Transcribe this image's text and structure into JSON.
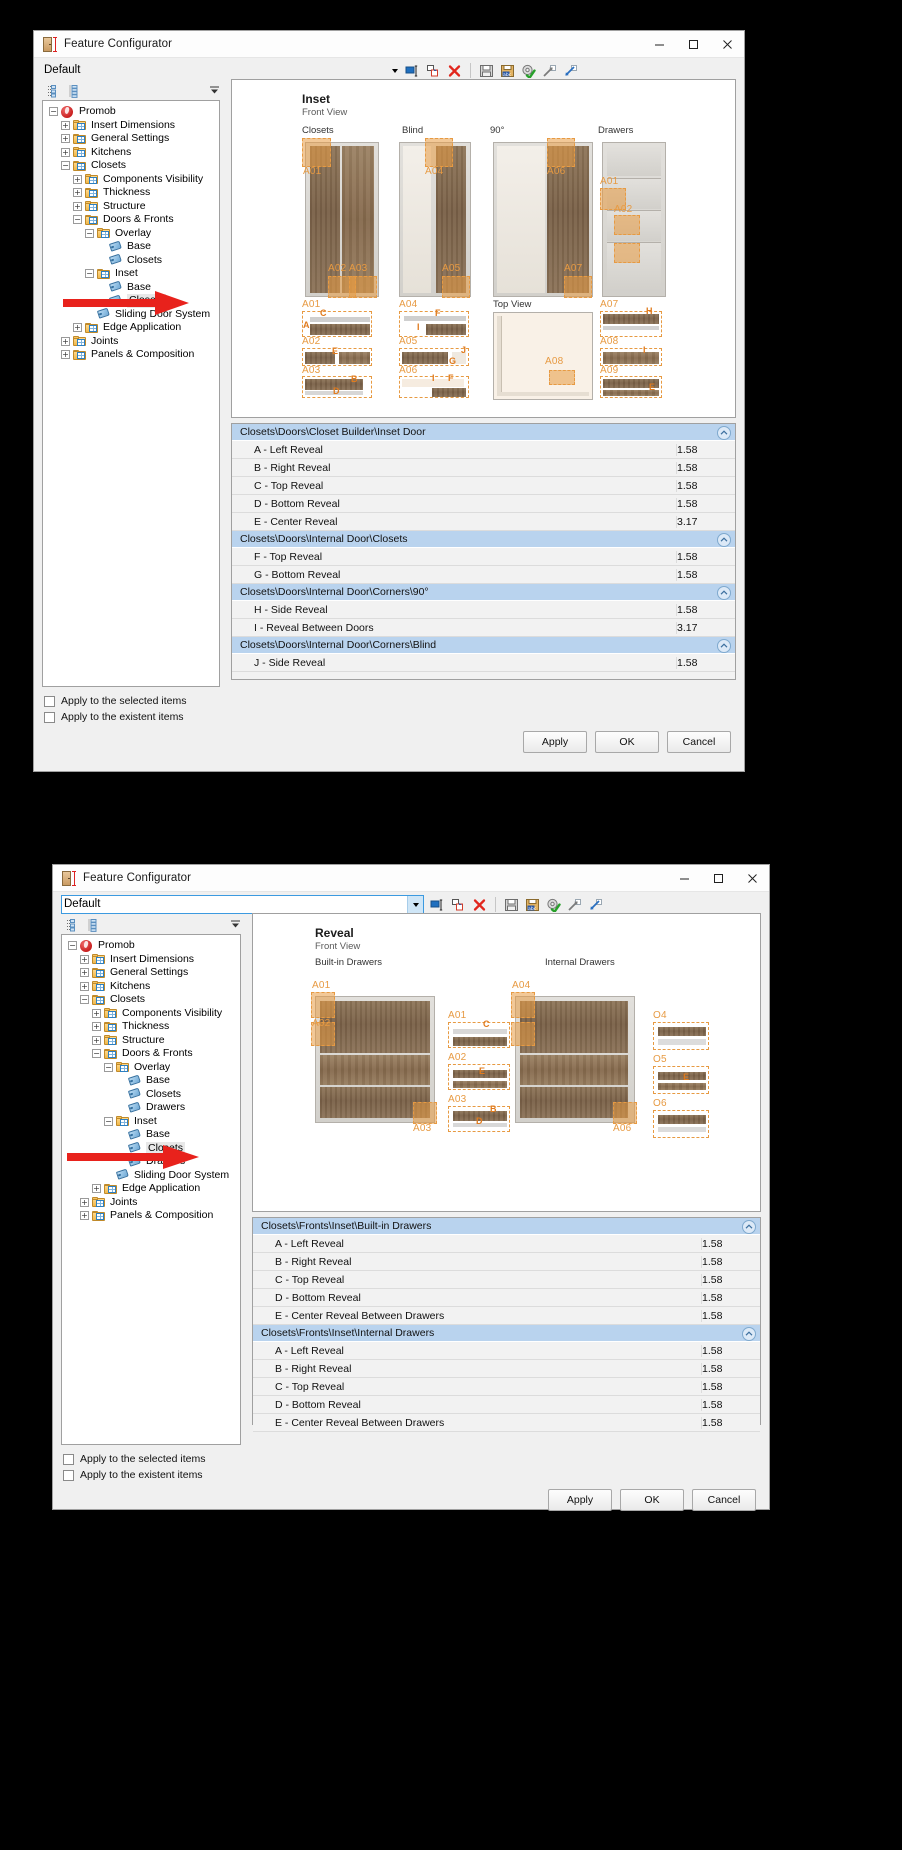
{
  "window1": {
    "title": "Feature Configurator",
    "profile_value": "Default",
    "window_buttons": {
      "minimize": "minimize-button",
      "maximize": "maximize-button",
      "close": "close-button"
    },
    "toolbar_icons": [
      "rename-icon",
      "duplicate-icon",
      "delete-icon",
      "save-icon",
      "save-as-icon",
      "validate-icon",
      "export-icon",
      "import-icon"
    ],
    "tree": [
      {
        "label": "Promob",
        "level": 0,
        "icon": "promob-icon",
        "expander": "-"
      },
      {
        "label": "Insert Dimensions",
        "level": 1,
        "icon": "folder-icon",
        "expander": "+"
      },
      {
        "label": "General Settings",
        "level": 1,
        "icon": "folder-icon",
        "expander": "+"
      },
      {
        "label": "Kitchens",
        "level": 1,
        "icon": "folder-icon",
        "expander": "+"
      },
      {
        "label": "Closets",
        "level": 1,
        "icon": "folder-icon",
        "expander": "-"
      },
      {
        "label": "Components Visibility",
        "level": 2,
        "icon": "folder-icon",
        "expander": "+"
      },
      {
        "label": "Thickness",
        "level": 2,
        "icon": "folder-icon",
        "expander": "+"
      },
      {
        "label": "Structure",
        "level": 2,
        "icon": "folder-icon",
        "expander": "+"
      },
      {
        "label": "Doors & Fronts",
        "level": 2,
        "icon": "folder-icon",
        "expander": "-"
      },
      {
        "label": "Overlay",
        "level": 3,
        "icon": "folder-icon",
        "expander": "-"
      },
      {
        "label": "Base",
        "level": 4,
        "icon": "tag-icon",
        "expander": ""
      },
      {
        "label": "Closets",
        "level": 4,
        "icon": "tag-icon",
        "expander": ""
      },
      {
        "label": "Inset",
        "level": 3,
        "icon": "folder-icon",
        "expander": "-"
      },
      {
        "label": "Base",
        "level": 4,
        "icon": "tag-icon",
        "expander": ""
      },
      {
        "label": "Closets",
        "level": 4,
        "icon": "tag-icon",
        "expander": "",
        "selected": true
      },
      {
        "label": "Sliding Door System",
        "level": 3,
        "icon": "tag-icon",
        "expander": ""
      },
      {
        "label": "Edge Application",
        "level": 2,
        "icon": "folder-icon",
        "expander": "+"
      },
      {
        "label": "Joints",
        "level": 1,
        "icon": "folder-icon",
        "expander": "+"
      },
      {
        "label": "Panels & Composition",
        "level": 1,
        "icon": "folder-icon",
        "expander": "+"
      }
    ],
    "preview": {
      "title": "Inset",
      "subtitle": "Front View",
      "columns": [
        "Closets",
        "Blind",
        "90°",
        "Drawers"
      ],
      "top_view_caption": "Top View",
      "callouts": [
        "A01",
        "A02",
        "A03",
        "A04",
        "A05",
        "A06",
        "A07",
        "A08",
        "A09"
      ],
      "dimension_letters": [
        "A",
        "B",
        "C",
        "D",
        "E",
        "F",
        "G",
        "H",
        "I",
        "J"
      ]
    },
    "property_groups": [
      {
        "header": "Closets\\Doors\\Closet Builder\\Inset Door",
        "rows": [
          {
            "name": "A - Left Reveal",
            "value": "1.58"
          },
          {
            "name": "B - Right Reveal",
            "value": "1.58"
          },
          {
            "name": "C - Top Reveal",
            "value": "1.58"
          },
          {
            "name": "D - Bottom Reveal",
            "value": "1.58"
          },
          {
            "name": "E - Center Reveal",
            "value": "3.17"
          }
        ]
      },
      {
        "header": "Closets\\Doors\\Internal Door\\Closets",
        "rows": [
          {
            "name": "F - Top Reveal",
            "value": "1.58"
          },
          {
            "name": "G - Bottom Reveal",
            "value": "1.58"
          }
        ]
      },
      {
        "header": "Closets\\Doors\\Internal Door\\Corners\\90°",
        "rows": [
          {
            "name": "H - Side Reveal",
            "value": "1.58"
          },
          {
            "name": "I - Reveal Between Doors",
            "value": "3.17"
          }
        ]
      },
      {
        "header": "Closets\\Doors\\Internal Door\\Corners\\Blind",
        "rows": [
          {
            "name": "J - Side Reveal",
            "value": "1.58"
          }
        ]
      }
    ],
    "footer": {
      "checkbox_selected": "Apply to the selected items",
      "checkbox_existent": "Apply to the existent items",
      "apply": "Apply",
      "ok": "OK",
      "cancel": "Cancel"
    }
  },
  "window2": {
    "title": "Feature Configurator",
    "profile_value": "Default",
    "window_buttons": {
      "minimize": "minimize-button",
      "maximize": "maximize-button",
      "close": "close-button"
    },
    "toolbar_icons": [
      "rename-icon",
      "duplicate-icon",
      "delete-icon",
      "save-icon",
      "save-as-icon",
      "validate-icon",
      "export-icon",
      "import-icon"
    ],
    "tree": [
      {
        "label": "Promob",
        "level": 0,
        "icon": "promob-icon",
        "expander": "-"
      },
      {
        "label": "Insert Dimensions",
        "level": 1,
        "icon": "folder-icon",
        "expander": "+"
      },
      {
        "label": "General Settings",
        "level": 1,
        "icon": "folder-icon",
        "expander": "+"
      },
      {
        "label": "Kitchens",
        "level": 1,
        "icon": "folder-icon",
        "expander": "+"
      },
      {
        "label": "Closets",
        "level": 1,
        "icon": "folder-icon",
        "expander": "-"
      },
      {
        "label": "Components Visibility",
        "level": 2,
        "icon": "folder-icon",
        "expander": "+"
      },
      {
        "label": "Thickness",
        "level": 2,
        "icon": "folder-icon",
        "expander": "+"
      },
      {
        "label": "Structure",
        "level": 2,
        "icon": "folder-icon",
        "expander": "+"
      },
      {
        "label": "Doors & Fronts",
        "level": 2,
        "icon": "folder-icon",
        "expander": "-"
      },
      {
        "label": "Overlay",
        "level": 3,
        "icon": "folder-icon",
        "expander": "-"
      },
      {
        "label": "Base",
        "level": 4,
        "icon": "tag-icon",
        "expander": ""
      },
      {
        "label": "Closets",
        "level": 4,
        "icon": "tag-icon",
        "expander": ""
      },
      {
        "label": "Drawers",
        "level": 4,
        "icon": "tag-icon",
        "expander": ""
      },
      {
        "label": "Inset",
        "level": 3,
        "icon": "folder-icon",
        "expander": "-"
      },
      {
        "label": "Base",
        "level": 4,
        "icon": "tag-icon",
        "expander": ""
      },
      {
        "label": "Closets",
        "level": 4,
        "icon": "tag-icon",
        "expander": "",
        "selected": true
      },
      {
        "label": "Drawers",
        "level": 4,
        "icon": "tag-icon",
        "expander": ""
      },
      {
        "label": "Sliding Door System",
        "level": 3,
        "icon": "tag-icon",
        "expander": ""
      },
      {
        "label": "Edge Application",
        "level": 2,
        "icon": "folder-icon",
        "expander": "+"
      },
      {
        "label": "Joints",
        "level": 1,
        "icon": "folder-icon",
        "expander": "+"
      },
      {
        "label": "Panels & Composition",
        "level": 1,
        "icon": "folder-icon",
        "expander": "+"
      }
    ],
    "preview": {
      "title": "Reveal",
      "subtitle": "Front View",
      "columns": [
        "Built-in Drawers",
        "Internal Drawers"
      ],
      "callouts": [
        "A01",
        "A02",
        "A03",
        "A04",
        "A05",
        "A06",
        "O4",
        "O5",
        "O6"
      ],
      "dimension_letters": [
        "A",
        "B",
        "C",
        "D",
        "E"
      ]
    },
    "property_groups": [
      {
        "header": "Closets\\Fronts\\Inset\\Built-in Drawers",
        "rows": [
          {
            "name": "A - Left Reveal",
            "value": "1.58"
          },
          {
            "name": "B - Right Reveal",
            "value": "1.58"
          },
          {
            "name": "C - Top Reveal",
            "value": "1.58"
          },
          {
            "name": "D - Bottom Reveal",
            "value": "1.58"
          },
          {
            "name": "E - Center Reveal Between Drawers",
            "value": "1.58"
          }
        ]
      },
      {
        "header": "Closets\\Fronts\\Inset\\Internal Drawers",
        "rows": [
          {
            "name": "A - Left Reveal",
            "value": "1.58"
          },
          {
            "name": "B - Right Reveal",
            "value": "1.58"
          },
          {
            "name": "C - Top Reveal",
            "value": "1.58"
          },
          {
            "name": "D - Bottom Reveal",
            "value": "1.58"
          },
          {
            "name": "E - Center Reveal Between Drawers",
            "value": "1.58"
          }
        ]
      }
    ],
    "footer": {
      "checkbox_selected": "Apply to the selected items",
      "checkbox_existent": "Apply to the existent items",
      "apply": "Apply",
      "ok": "OK",
      "cancel": "Cancel"
    }
  },
  "colors": {
    "group_header": "#b9d3ee",
    "annotation_orange": "#e79a42",
    "arrow_red": "#e8221c",
    "accent_blue": "#3c9ae0"
  }
}
